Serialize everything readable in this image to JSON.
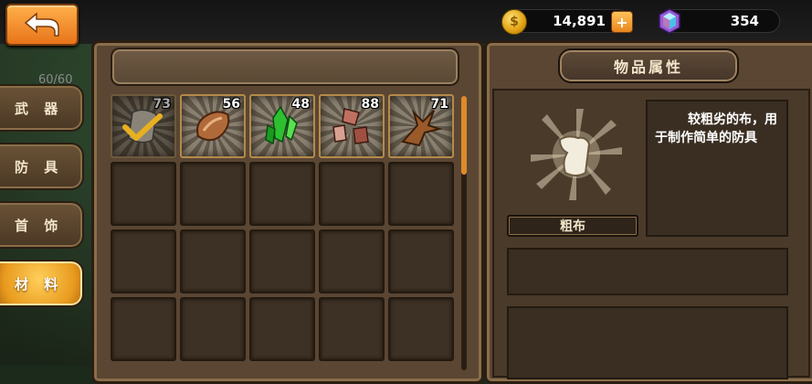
{
  "currency": {
    "coins": "14,891",
    "gems": "354",
    "coin_symbol": "$",
    "plus_label": "+"
  },
  "sidebar": {
    "capacity": "60/60",
    "tabs": [
      {
        "label": "武 器",
        "active": false
      },
      {
        "label": "防 具",
        "active": false
      },
      {
        "label": "首 饰",
        "active": false
      },
      {
        "label": "材 料",
        "active": true
      }
    ]
  },
  "inventory": {
    "items": [
      {
        "icon": "cloth-checkmark-icon",
        "count": "73",
        "equipped": true
      },
      {
        "icon": "leather-icon",
        "count": "56"
      },
      {
        "icon": "green-crystal-icon",
        "count": "48"
      },
      {
        "icon": "ore-shards-icon",
        "count": "88"
      },
      {
        "icon": "wood-branch-icon",
        "count": "71"
      }
    ]
  },
  "detail": {
    "title": "物品属性",
    "item_name": "粗布",
    "item_icon": "cloth-icon",
    "description": "较粗劣的布，用于制作简单的防具"
  },
  "colors": {
    "accent": "#e8861e",
    "panel": "#5a4633",
    "panel_border": "#2a1e12"
  }
}
